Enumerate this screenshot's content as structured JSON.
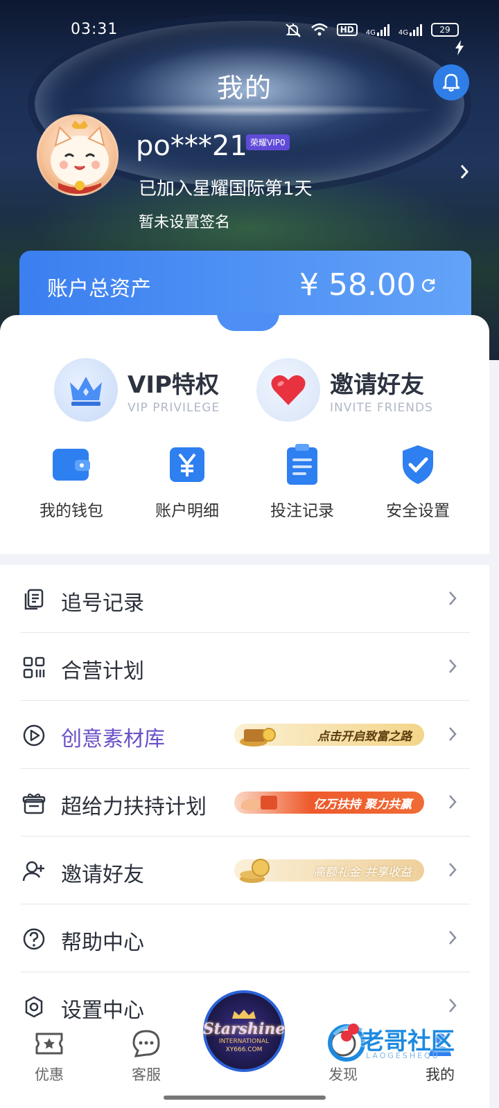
{
  "status_bar": {
    "time": "03:31",
    "hd_label": "HD",
    "net1": "4G",
    "net2": "4G",
    "battery": "29"
  },
  "header": {
    "title": "我的"
  },
  "profile": {
    "username": "po***21",
    "vip_badge": "荣耀VIP0",
    "joined_text": "已加入星耀国际第1天",
    "signature": "暂未设置签名"
  },
  "assets": {
    "label": "账户总资产",
    "value": "¥ 58.00"
  },
  "promos": [
    {
      "title": "VIP特权",
      "subtitle": "VIP PRIVILEGE",
      "icon": "crown-icon"
    },
    {
      "title": "邀请好友",
      "subtitle": "INVITE FRIENDS",
      "icon": "heart-icon"
    }
  ],
  "quick_actions": [
    {
      "label": "我的钱包",
      "icon": "wallet-icon"
    },
    {
      "label": "账户明细",
      "icon": "yuan-icon"
    },
    {
      "label": "投注记录",
      "icon": "clipboard-icon"
    },
    {
      "label": "安全设置",
      "icon": "shield-check-icon"
    }
  ],
  "menu": [
    {
      "label": "追号记录",
      "icon": "records-icon"
    },
    {
      "label": "合营计划",
      "icon": "grid-icon"
    },
    {
      "label": "创意素材库",
      "icon": "play-icon",
      "banner": "点击开启致富之路",
      "label_color": "#6b4fc8"
    },
    {
      "label": "超给力扶持计划",
      "icon": "gift-icon",
      "banner": "亿万扶持 聚力共赢"
    },
    {
      "label": "邀请好友",
      "icon": "add-user-icon",
      "banner": "高额礼金 共享收益"
    },
    {
      "label": "帮助中心",
      "icon": "help-icon"
    },
    {
      "label": "设置中心",
      "icon": "settings-icon"
    }
  ],
  "bottom_nav": [
    {
      "label": "优惠",
      "icon": "ticket-icon"
    },
    {
      "label": "客服",
      "icon": "chat-icon"
    },
    {
      "label": "发现",
      "icon": "discover-icon"
    },
    {
      "label": "我的",
      "icon": "user-icon"
    }
  ],
  "center_logo": {
    "line1": "Starshine",
    "line2": "INTERNATIONAL",
    "line3": "XY666.COM"
  },
  "watermark": {
    "text": "老哥社区",
    "sub": "LAOGESHEQU"
  },
  "colors": {
    "primary": "#3b7ff0",
    "accent_purple": "#6b4fc8"
  }
}
